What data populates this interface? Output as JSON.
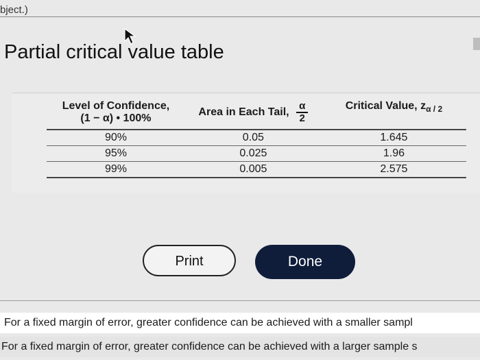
{
  "header": {
    "crumb": "bject.)"
  },
  "page": {
    "title": "Partial critical value table"
  },
  "table": {
    "headers": {
      "confidence_line1": "Level of Confidence,",
      "confidence_line2": "(1 − α) • 100%",
      "area": "Area in Each Tail,",
      "area_frac_num": "α",
      "area_frac_den": "2",
      "critical": "Critical Value, z",
      "critical_sub": "α / 2"
    },
    "rows": [
      {
        "confidence": "90%",
        "area": "0.05",
        "critical": "1.645"
      },
      {
        "confidence": "95%",
        "area": "0.025",
        "critical": "1.96"
      },
      {
        "confidence": "99%",
        "area": "0.005",
        "critical": "2.575"
      }
    ]
  },
  "buttons": {
    "print": "Print",
    "done": "Done"
  },
  "answers": [
    "For a fixed margin of error, greater confidence can be achieved with a smaller sampl",
    "For a fixed margin of error, greater confidence can be achieved with a larger sample s"
  ],
  "colors": {
    "done_bg": "#0f1d3a",
    "background": "#e9e9ea"
  }
}
